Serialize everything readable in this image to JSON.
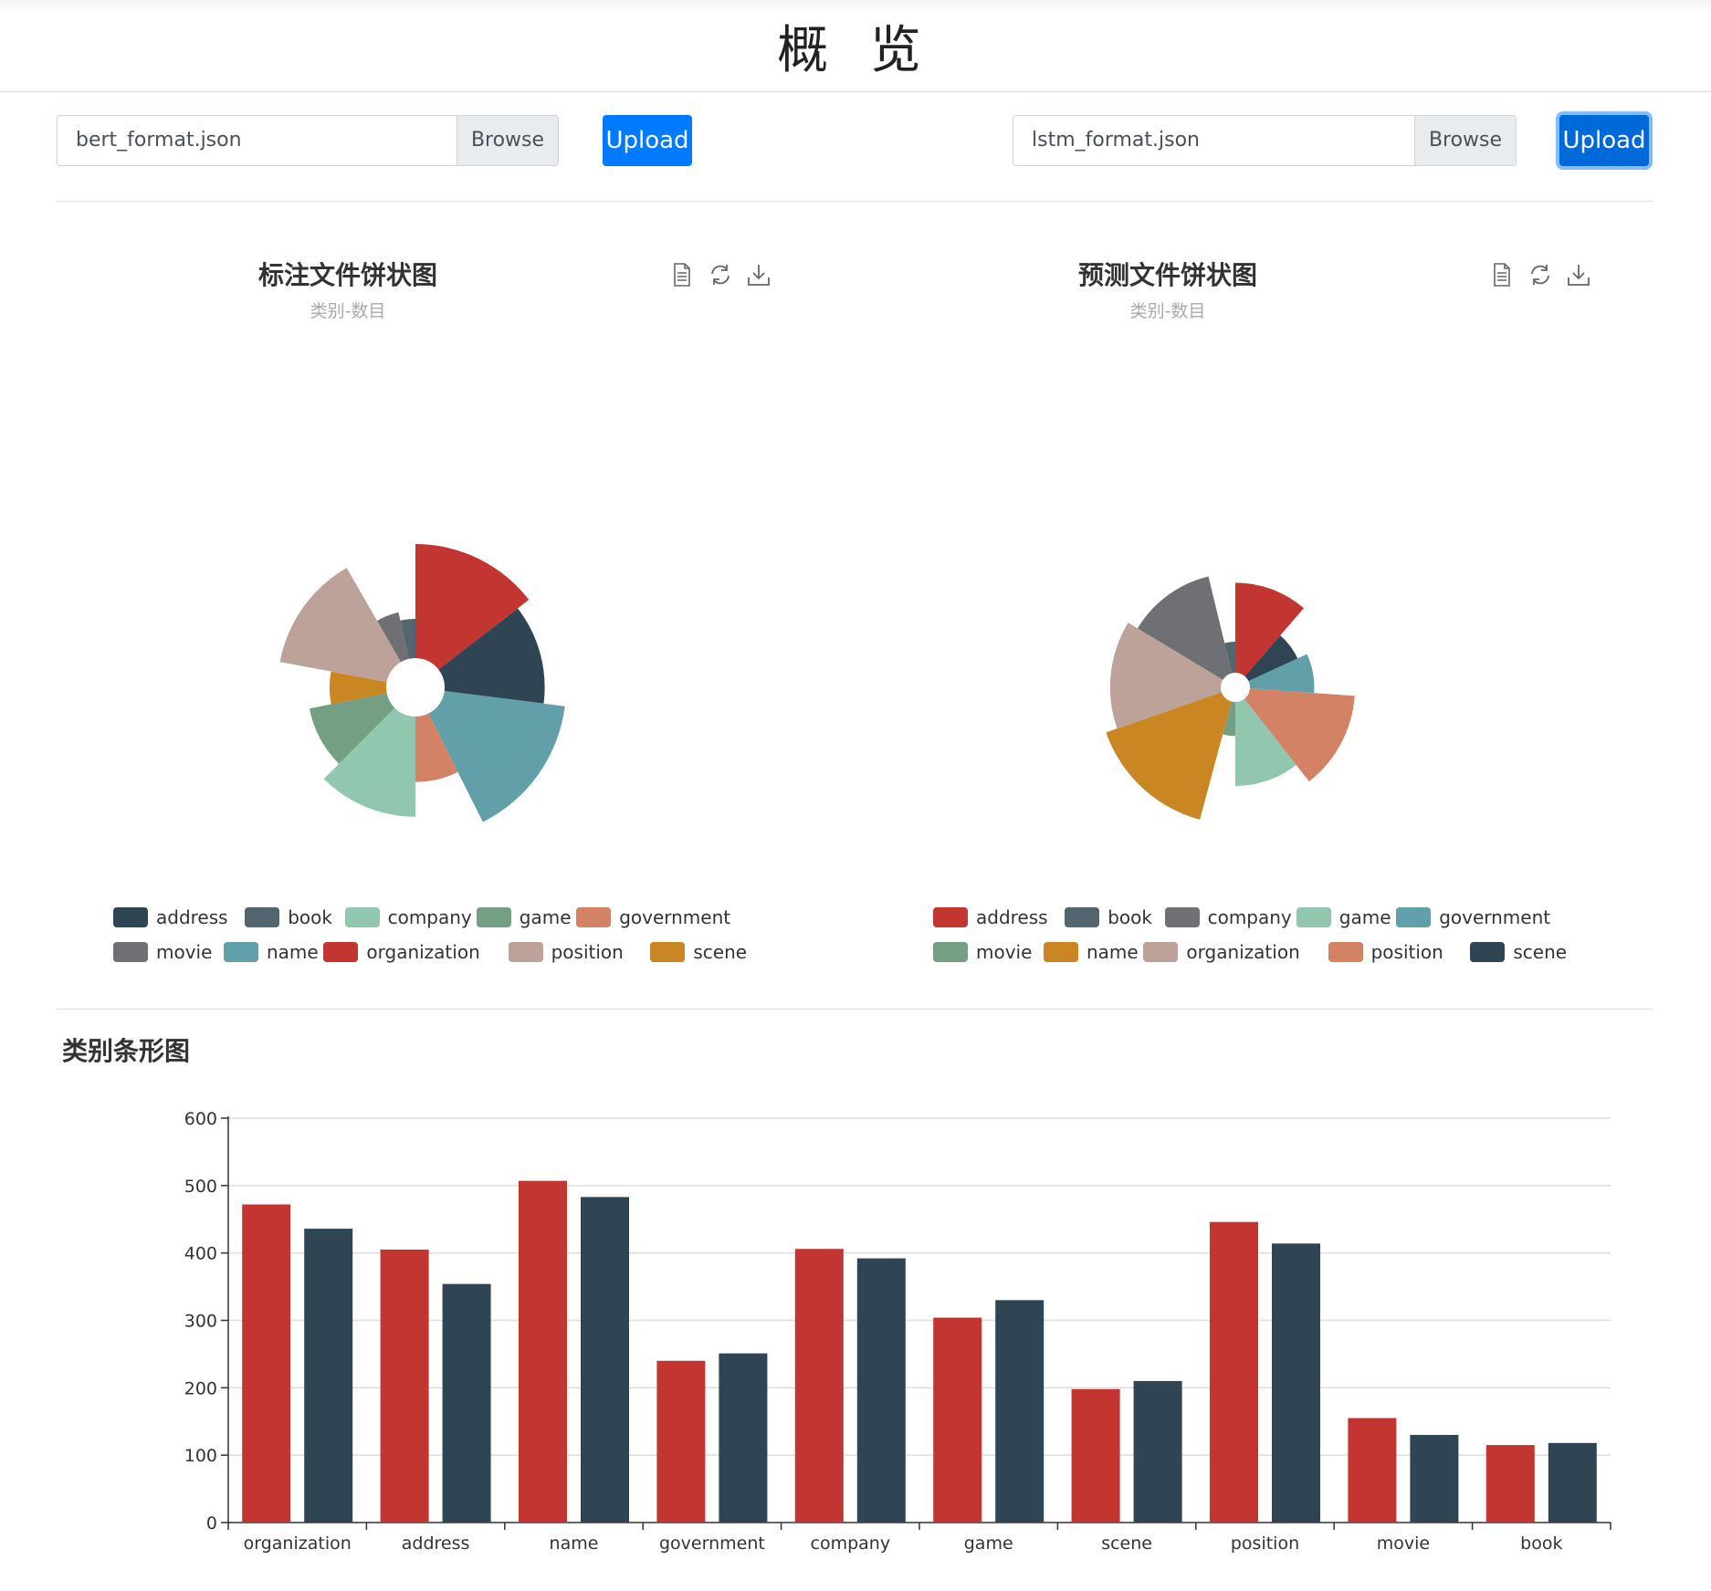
{
  "header": {
    "title": "概 览"
  },
  "uploads": {
    "left": {
      "file_name": "bert_format.json",
      "browse_label": "Browse",
      "upload_label": "Upload"
    },
    "right": {
      "file_name": "lstm_format.json",
      "browse_label": "Browse",
      "upload_label": "Upload"
    }
  },
  "toolbox": {
    "icons": [
      "data-view-icon",
      "restore-icon",
      "save-image-icon"
    ]
  },
  "section": {
    "bar_title": "类别条形图"
  },
  "chart_data": [
    {
      "type": "pie",
      "rose_type": "radius",
      "title": "标注文件饼状图",
      "subtitle": "类别-数目",
      "legend": [
        "address",
        "book",
        "company",
        "game",
        "government",
        "movie",
        "name",
        "organization",
        "position",
        "scene"
      ],
      "slices": [
        {
          "name": "organization",
          "value": 472,
          "color": "#c23531"
        },
        {
          "name": "address",
          "value": 405,
          "color": "#2f4554"
        },
        {
          "name": "name",
          "value": 507,
          "color": "#61a0a8"
        },
        {
          "name": "government",
          "value": 240,
          "color": "#d48265"
        },
        {
          "name": "company",
          "value": 406,
          "color": "#91c7ae"
        },
        {
          "name": "game",
          "value": 304,
          "color": "#749f83"
        },
        {
          "name": "scene",
          "value": 198,
          "color": "#ca8622"
        },
        {
          "name": "position",
          "value": 446,
          "color": "#bda29a"
        },
        {
          "name": "movie",
          "value": 155,
          "color": "#6e7074"
        },
        {
          "name": "book",
          "value": 115,
          "color": "#546570"
        }
      ],
      "legend_colors": {
        "address": "#2f4554",
        "book": "#546570",
        "company": "#91c7ae",
        "game": "#749f83",
        "government": "#d48265",
        "movie": "#6e7074",
        "name": "#61a0a8",
        "organization": "#c23531",
        "position": "#bda29a",
        "scene": "#ca8622"
      }
    },
    {
      "type": "pie",
      "rose_type": "radius",
      "title": "预测文件饼状图",
      "subtitle": "类别-数目",
      "legend": [
        "address",
        "book",
        "company",
        "game",
        "government",
        "movie",
        "name",
        "organization",
        "position",
        "scene"
      ],
      "slices": [
        {
          "name": "address",
          "value": 354,
          "color": "#c23531"
        },
        {
          "name": "scene",
          "value": 210,
          "color": "#2f4554"
        },
        {
          "name": "government",
          "value": 251,
          "color": "#61a0a8"
        },
        {
          "name": "position",
          "value": 414,
          "color": "#d48265"
        },
        {
          "name": "game",
          "value": 330,
          "color": "#91c7ae"
        },
        {
          "name": "movie",
          "value": 130,
          "color": "#749f83"
        },
        {
          "name": "name",
          "value": 483,
          "color": "#ca8622"
        },
        {
          "name": "organization",
          "value": 436,
          "color": "#bda29a"
        },
        {
          "name": "company",
          "value": 392,
          "color": "#6e7074"
        },
        {
          "name": "book",
          "value": 118,
          "color": "#546570"
        }
      ],
      "legend_colors": {
        "address": "#c23531",
        "book": "#546570",
        "company": "#6e7074",
        "game": "#91c7ae",
        "government": "#61a0a8",
        "movie": "#749f83",
        "name": "#ca8622",
        "organization": "#bda29a",
        "position": "#d48265",
        "scene": "#2f4554"
      }
    },
    {
      "type": "bar",
      "title": "",
      "categories": [
        "organization",
        "address",
        "name",
        "government",
        "company",
        "game",
        "scene",
        "position",
        "movie",
        "book"
      ],
      "series": [
        {
          "values": [
            472,
            405,
            507,
            240,
            406,
            304,
            198,
            446,
            155,
            115
          ],
          "color": "#c23531"
        },
        {
          "values": [
            436,
            354,
            483,
            251,
            392,
            330,
            210,
            414,
            130,
            118
          ],
          "color": "#2f4554"
        }
      ],
      "ylim": [
        0,
        600
      ],
      "yticks": [
        0,
        100,
        200,
        300,
        400,
        500,
        600
      ],
      "grid": true
    }
  ]
}
